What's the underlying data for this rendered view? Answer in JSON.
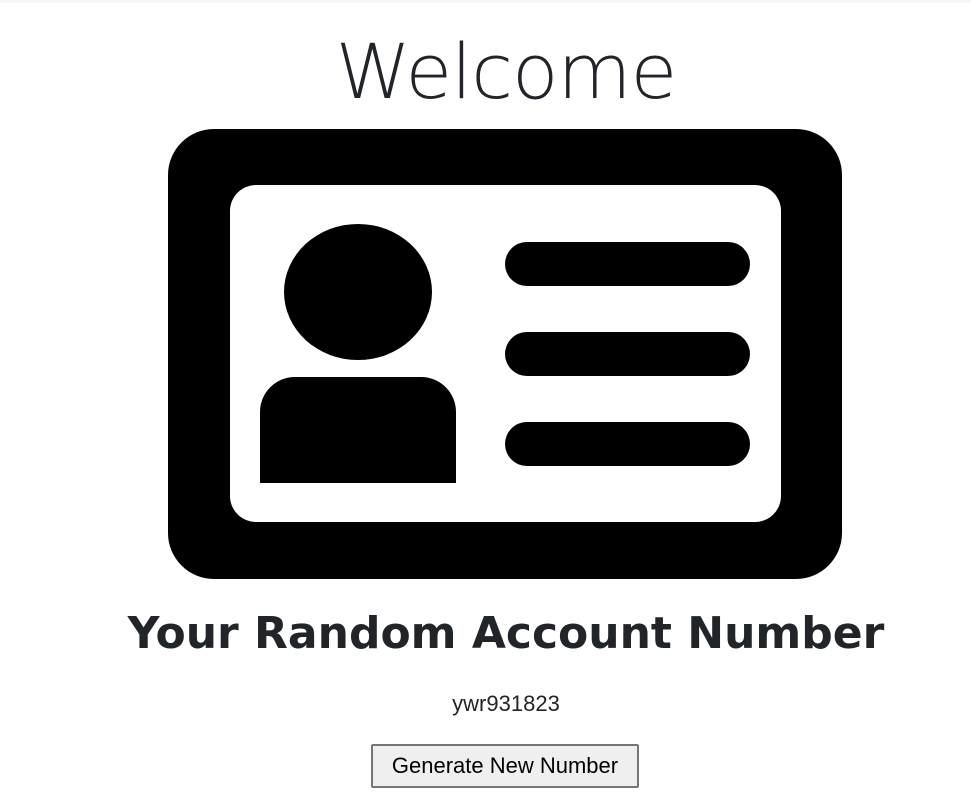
{
  "page": {
    "title": "Welcome",
    "icon": "id-card-icon"
  },
  "account": {
    "heading": "Your Random Account Number",
    "number": "ywr931823"
  },
  "actions": {
    "generate_label": "Generate New Number"
  }
}
